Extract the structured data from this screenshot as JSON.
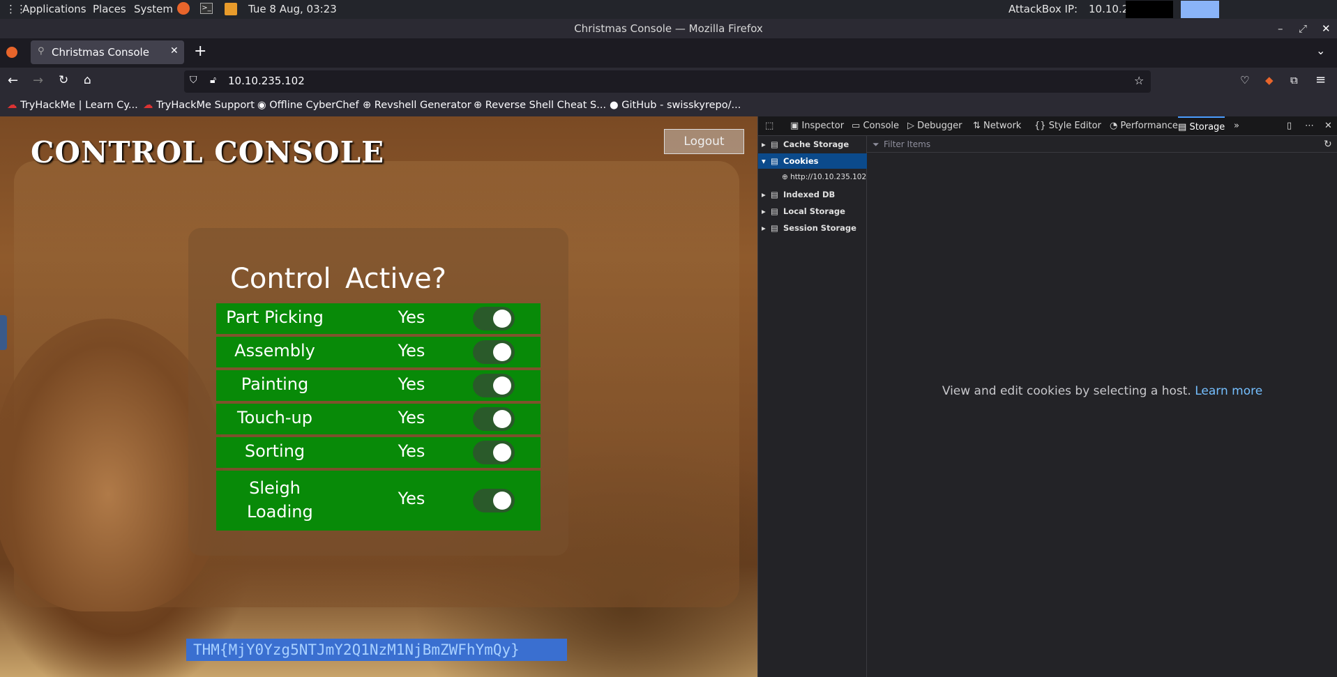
{
  "system_panel": {
    "applications": "Applications",
    "places": "Places",
    "system": "System",
    "datetime": "Tue 8 Aug, 03:23",
    "attackbox_label": "AttackBox IP:",
    "attackbox_ip": "10.10.255.198"
  },
  "window_title": "Christmas Console — Mozilla Firefox",
  "tab": {
    "label": "Christmas Console"
  },
  "url": "10.10.235.102",
  "bookmarks": [
    "TryHackMe | Learn Cy...",
    "TryHackMe Support",
    "Offline CyberChef",
    "Revshell Generator",
    "Reverse Shell Cheat S...",
    "GitHub - swisskyrepo/..."
  ],
  "page": {
    "title": "CONTROL CONSOLE",
    "logout_label": "Logout",
    "header_control": "Control",
    "header_active": "Active?",
    "rows": [
      {
        "label": "Part Picking",
        "active": "Yes"
      },
      {
        "label": "Assembly",
        "active": "Yes"
      },
      {
        "label": "Painting",
        "active": "Yes"
      },
      {
        "label": "Touch-up",
        "active": "Yes"
      },
      {
        "label": "Sorting",
        "active": "Yes"
      },
      {
        "label": "Sleigh Loading",
        "active": "Yes"
      }
    ],
    "flag_text": "THM{MjY0Yzg5NTJmY2Q1NzM1NjBmZWFhYmQy}"
  },
  "devtools": {
    "tabs": [
      "Inspector",
      "Console",
      "Debugger",
      "Network",
      "Style Editor",
      "Performance",
      "Storage"
    ],
    "active_tab": "Storage",
    "storage_tree": [
      "Cache Storage",
      "Cookies",
      "http://10.10.235.102",
      "Indexed DB",
      "Local Storage",
      "Session Storage"
    ],
    "filter_placeholder": "Filter Items",
    "cookie_message": "View and edit cookies by selecting a host.",
    "learn_more": "Learn more"
  },
  "colors": {
    "row_green": "#088a08",
    "toggle_track": "#2a5a2a",
    "devtools_selected": "#0b4a8b",
    "link": "#75bfff"
  }
}
